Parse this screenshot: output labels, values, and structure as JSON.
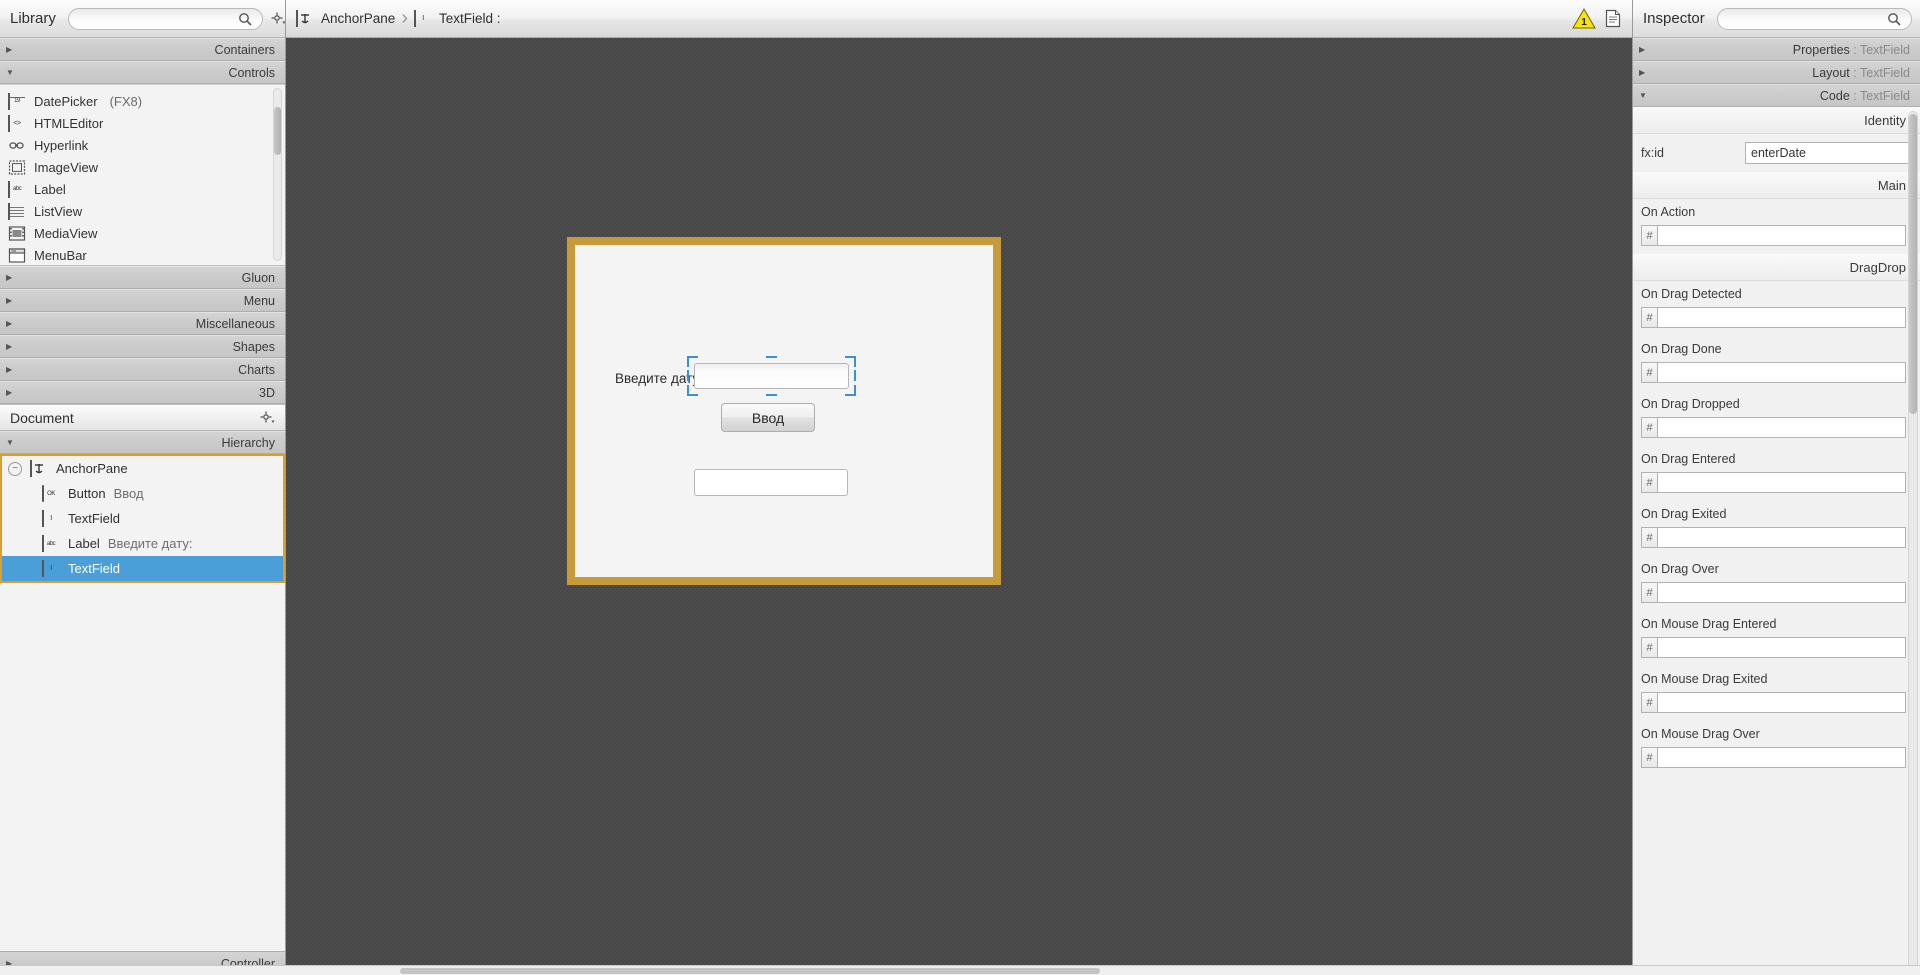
{
  "library": {
    "title": "Library",
    "search_placeholder": "",
    "search_value": "",
    "search_icon": "search-icon",
    "gear_icon": "gear-icon",
    "categories_top": [
      {
        "label": "Containers",
        "expanded": false
      },
      {
        "label": "Controls",
        "expanded": true
      }
    ],
    "controls_items": [
      {
        "name": "DatePicker",
        "suffix": "(FX8)",
        "icon": "datepicker-icon"
      },
      {
        "name": "HTMLEditor",
        "suffix": "",
        "icon": "htmleditor-icon"
      },
      {
        "name": "Hyperlink",
        "suffix": "",
        "icon": "hyperlink-icon"
      },
      {
        "name": "ImageView",
        "suffix": "",
        "icon": "imageview-icon"
      },
      {
        "name": "Label",
        "suffix": "",
        "icon": "label-icon"
      },
      {
        "name": "ListView",
        "suffix": "",
        "icon": "listview-icon"
      },
      {
        "name": "MediaView",
        "suffix": "",
        "icon": "mediaview-icon"
      },
      {
        "name": "MenuBar",
        "suffix": "",
        "icon": "menubar-icon"
      }
    ],
    "categories_bottom": [
      {
        "label": "Gluon",
        "expanded": false
      },
      {
        "label": "Menu",
        "expanded": false
      },
      {
        "label": "Miscellaneous",
        "expanded": false
      },
      {
        "label": "Shapes",
        "expanded": false
      },
      {
        "label": "Charts",
        "expanded": false
      },
      {
        "label": "3D",
        "expanded": false
      }
    ]
  },
  "document": {
    "title": "Document",
    "gear_icon": "gear-icon",
    "hierarchy_label": "Hierarchy",
    "controller_label": "Controller",
    "tree": [
      {
        "type": "AnchorPane",
        "value": "",
        "depth": 0,
        "icon": "anchorpane-icon",
        "selected": false,
        "expander": "−"
      },
      {
        "type": "Button",
        "value": "Ввод",
        "depth": 1,
        "icon": "button-icon",
        "selected": false,
        "expander": ""
      },
      {
        "type": "TextField",
        "value": "",
        "depth": 1,
        "icon": "textfield-icon",
        "selected": false,
        "expander": ""
      },
      {
        "type": "Label",
        "value": "Введите дату:",
        "depth": 1,
        "icon": "label-icon",
        "selected": false,
        "expander": ""
      },
      {
        "type": "TextField",
        "value": "",
        "depth": 1,
        "icon": "textfield-icon",
        "selected": true,
        "expander": ""
      }
    ]
  },
  "breadcrumb": {
    "items": [
      {
        "label": "AnchorPane",
        "icon": "anchorpane-icon"
      },
      {
        "label": "TextField :",
        "icon": "textfield-icon"
      }
    ],
    "separator": "›",
    "warning_count": "1",
    "warning_icon": "warning-triangle-icon",
    "preview_icon": "document-preview-icon"
  },
  "canvas": {
    "label_text": "Введите дату:",
    "button_text": "Ввод",
    "textfield1_value": "",
    "textfield2_value": "",
    "selection_color": "#3b8fd4",
    "stage_border_color": "#c79a3c",
    "stage_background": "#f4f4f4"
  },
  "inspector": {
    "title": "Inspector",
    "search_placeholder": "",
    "search_value": "",
    "search_icon": "search-icon",
    "gear_icon": "gear-icon",
    "accordions": [
      {
        "label": "Properties",
        "sub": " : TextField",
        "expanded": false
      },
      {
        "label": "Layout",
        "sub": " : TextField",
        "expanded": false
      },
      {
        "label": "Code",
        "sub": " : TextField",
        "expanded": true
      }
    ],
    "sections": [
      {
        "title": "Identity",
        "kind": "identity",
        "fields": [
          {
            "label": "fx:id",
            "value": "enterDate"
          }
        ]
      },
      {
        "title": "Main",
        "kind": "handlers",
        "fields": [
          {
            "label": "On Action",
            "value": "",
            "prefix": "#"
          }
        ]
      },
      {
        "title": "DragDrop",
        "kind": "handlers",
        "fields": [
          {
            "label": "On Drag Detected",
            "value": "",
            "prefix": "#"
          },
          {
            "label": "On Drag Done",
            "value": "",
            "prefix": "#"
          },
          {
            "label": "On Drag Dropped",
            "value": "",
            "prefix": "#"
          },
          {
            "label": "On Drag Entered",
            "value": "",
            "prefix": "#"
          },
          {
            "label": "On Drag Exited",
            "value": "",
            "prefix": "#"
          },
          {
            "label": "On Drag Over",
            "value": "",
            "prefix": "#"
          },
          {
            "label": "On Mouse Drag Entered",
            "value": "",
            "prefix": "#"
          },
          {
            "label": "On Mouse Drag Exited",
            "value": "",
            "prefix": "#"
          },
          {
            "label": "On Mouse Drag Over",
            "value": "",
            "prefix": "#"
          }
        ]
      }
    ]
  }
}
